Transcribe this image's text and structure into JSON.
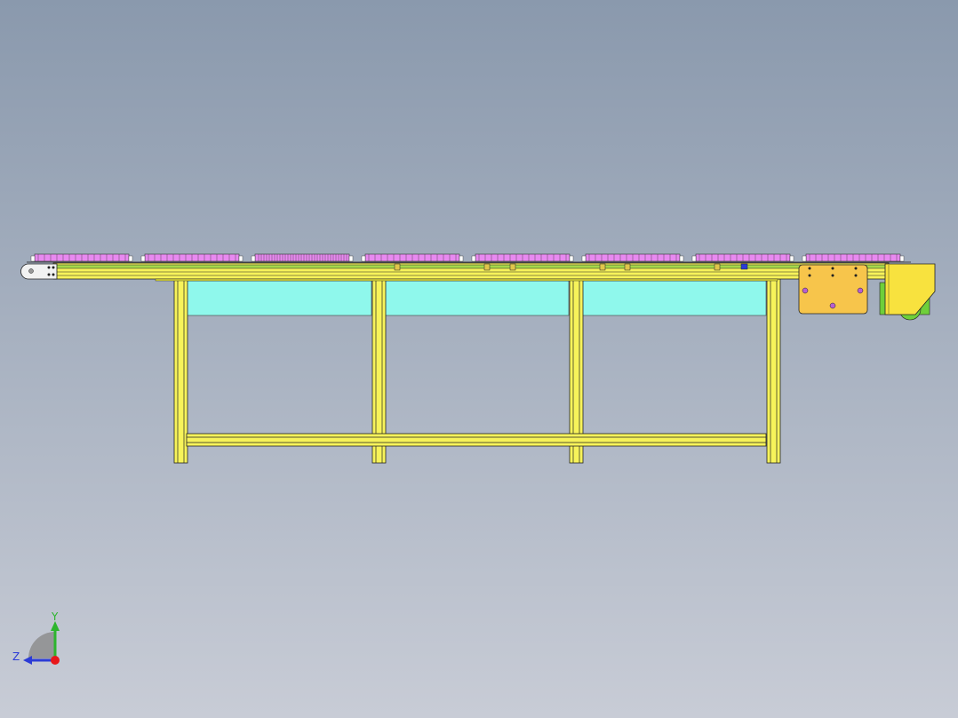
{
  "viewport": {
    "background_top": "#8a99ad",
    "background_bottom": "#c8ccd6"
  },
  "colors": {
    "frame_yellow": "#f7f35a",
    "frame_outline": "#222222",
    "conveyor_green": "#a6d84a",
    "panel_cyan": "#8ff8ec",
    "pallet_magenta": "#e889f0",
    "motor_orange": "#f7c54b",
    "motor_yellow": "#f8e23e",
    "gear_green": "#6fcf3a",
    "idler_white": "#f2f2f2"
  },
  "triad": {
    "y_label": "Y",
    "z_label": "Z",
    "y_color": "#2db52d",
    "z_color": "#2b3bd6",
    "origin_color": "#e8171a"
  }
}
